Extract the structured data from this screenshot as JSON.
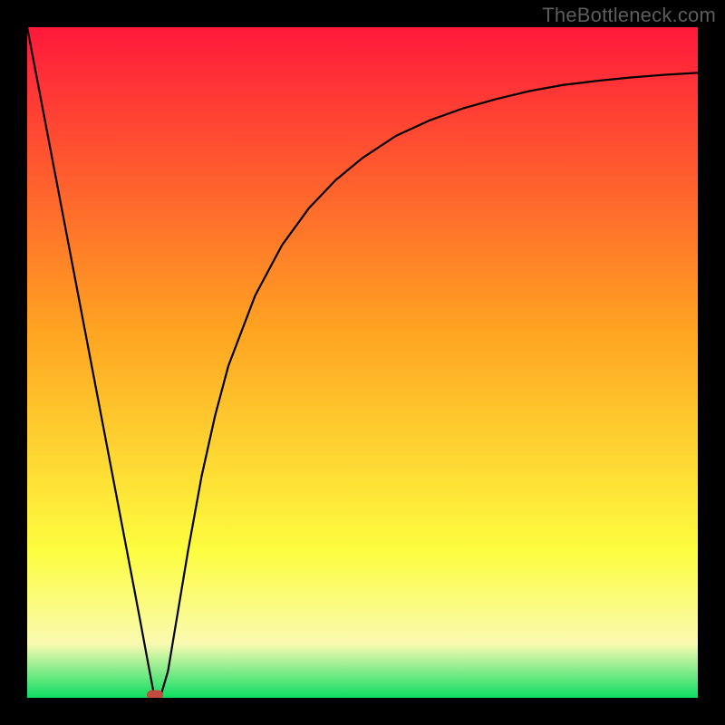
{
  "watermark": "TheBottleneck.com",
  "colors": {
    "top": "#ff193b",
    "mid": "#ffa321",
    "lower": "#fdfd3f",
    "lower2": "#f9fab1",
    "bottom": "#0ddd62",
    "frame": "#000000",
    "curve": "#000000",
    "marker": "#c24a3f"
  },
  "chart_data": {
    "type": "line",
    "title": "",
    "xlabel": "",
    "ylabel": "",
    "xlim": [
      0,
      100
    ],
    "ylim": [
      0,
      100
    ],
    "marker": {
      "x": 19,
      "y": 0
    },
    "x": [
      0,
      2,
      4,
      6,
      8,
      10,
      12,
      14,
      16,
      17,
      18,
      19,
      20,
      21,
      22,
      24,
      26,
      28,
      30,
      34,
      38,
      42,
      46,
      50,
      55,
      60,
      65,
      70,
      75,
      80,
      85,
      90,
      95,
      100
    ],
    "values": [
      100,
      89.5,
      79,
      68.5,
      58,
      47.5,
      37,
      26.5,
      16,
      10.7,
      5.3,
      0,
      0.6,
      4,
      10,
      22,
      33,
      42,
      49.5,
      60,
      67.5,
      73,
      77.2,
      80.5,
      83.8,
      86.1,
      87.9,
      89.3,
      90.5,
      91.4,
      92,
      92.5,
      92.9,
      93.2
    ]
  }
}
